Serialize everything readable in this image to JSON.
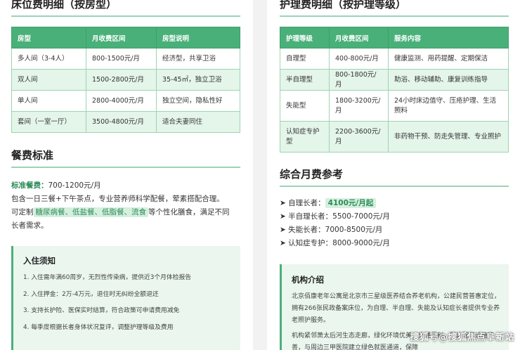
{
  "bed_section": {
    "title": "床位费明细（按房型）",
    "headers": [
      "房型",
      "月收费区间",
      "房型说明"
    ],
    "rows": [
      [
        "多人间（3-4人）",
        "800-1500元/月",
        "经济型，共享卫浴"
      ],
      [
        "双人间",
        "1500-2800元/月",
        "35-45㎡，独立卫浴"
      ],
      [
        "单人间",
        "2800-4000元/月",
        "独立空间，隐私性好"
      ],
      [
        "套间（一室一厅）",
        "3500-4800元/月",
        "适合夫妻同住"
      ]
    ]
  },
  "care_section": {
    "title": "护理费明细（按护理等级）",
    "headers": [
      "护理等级",
      "月收费区间",
      "服务内容"
    ],
    "rows": [
      [
        "自理型",
        "400-800元/月",
        "健康监测、用药提醒、定期保洁"
      ],
      [
        "半自理型",
        "800-1800元/月",
        "助浴、移动辅助、康复训练指导"
      ],
      [
        "失能型",
        "1800-3200元/月",
        "24小时床边值守、压疮护理、生活照料"
      ],
      [
        "认知症专护型",
        "2200-3600元/月",
        "非药物干预、防走失管理、专业照护"
      ]
    ]
  },
  "meal_section": {
    "title": "餐费标准",
    "standard_label": "标准餐费：",
    "standard_value": "700-1200元/月",
    "line1": "包含一日三餐+下午茶点，专业营养师科学配餐，荤素搭配合理。",
    "line2_prefix": "可定制",
    "line2_highlight": "糖尿病餐、低盐餐、低脂餐、流食",
    "line2_suffix": "等个性化膳食，满足不同",
    "line3": "长者需求。"
  },
  "notice_box": {
    "title": "入住须知",
    "items": [
      "1. 入住需年满60周岁，无烈性传染病，提供近3个月体检报告",
      "2. 入住押金：2万-4万元，退住时无纠纷全额退还",
      "3. 支持长护险、医保实时结算，符合政策可申请费用减免",
      "4. 每季度根据长者身体状况复评，调整护理等级及费用"
    ]
  },
  "monthly_section": {
    "title": "综合月费参考",
    "items": [
      {
        "bullet": "➤",
        "label": "自理长者：",
        "value": "4100元/月起",
        "highlight": true
      },
      {
        "bullet": "➤",
        "label": "半自理长者：",
        "value": "5500-7000元/月",
        "highlight": false
      },
      {
        "bullet": "➤",
        "label": "失能长者：",
        "value": "7000-8500元/月",
        "highlight": false
      },
      {
        "bullet": "➤",
        "label": "认知症专护：",
        "value": "8000-9000元/月",
        "highlight": false
      }
    ]
  },
  "org_box": {
    "title": "机构介绍",
    "paragraph1": "北京佰康老年公寓是北京市三星级医养结合养老机构，公建民营普惠定位，拥有266张民政备案床位，为自理、半自理、失能及认知症长者提供专业养老照护服务。",
    "paragraph2": "机构紧邻萧太后河生态走廊，绿化环境优美，交通便利，周边配套设施完善，与周边三甲医院建立绿色就医通道，保障"
  },
  "watermark": "搜狐号@搜狐焦点阜新站",
  "colors": {
    "accent": "#49b079",
    "row_alt": "#e4f5ea",
    "box_bg": "#eaf6ee"
  }
}
